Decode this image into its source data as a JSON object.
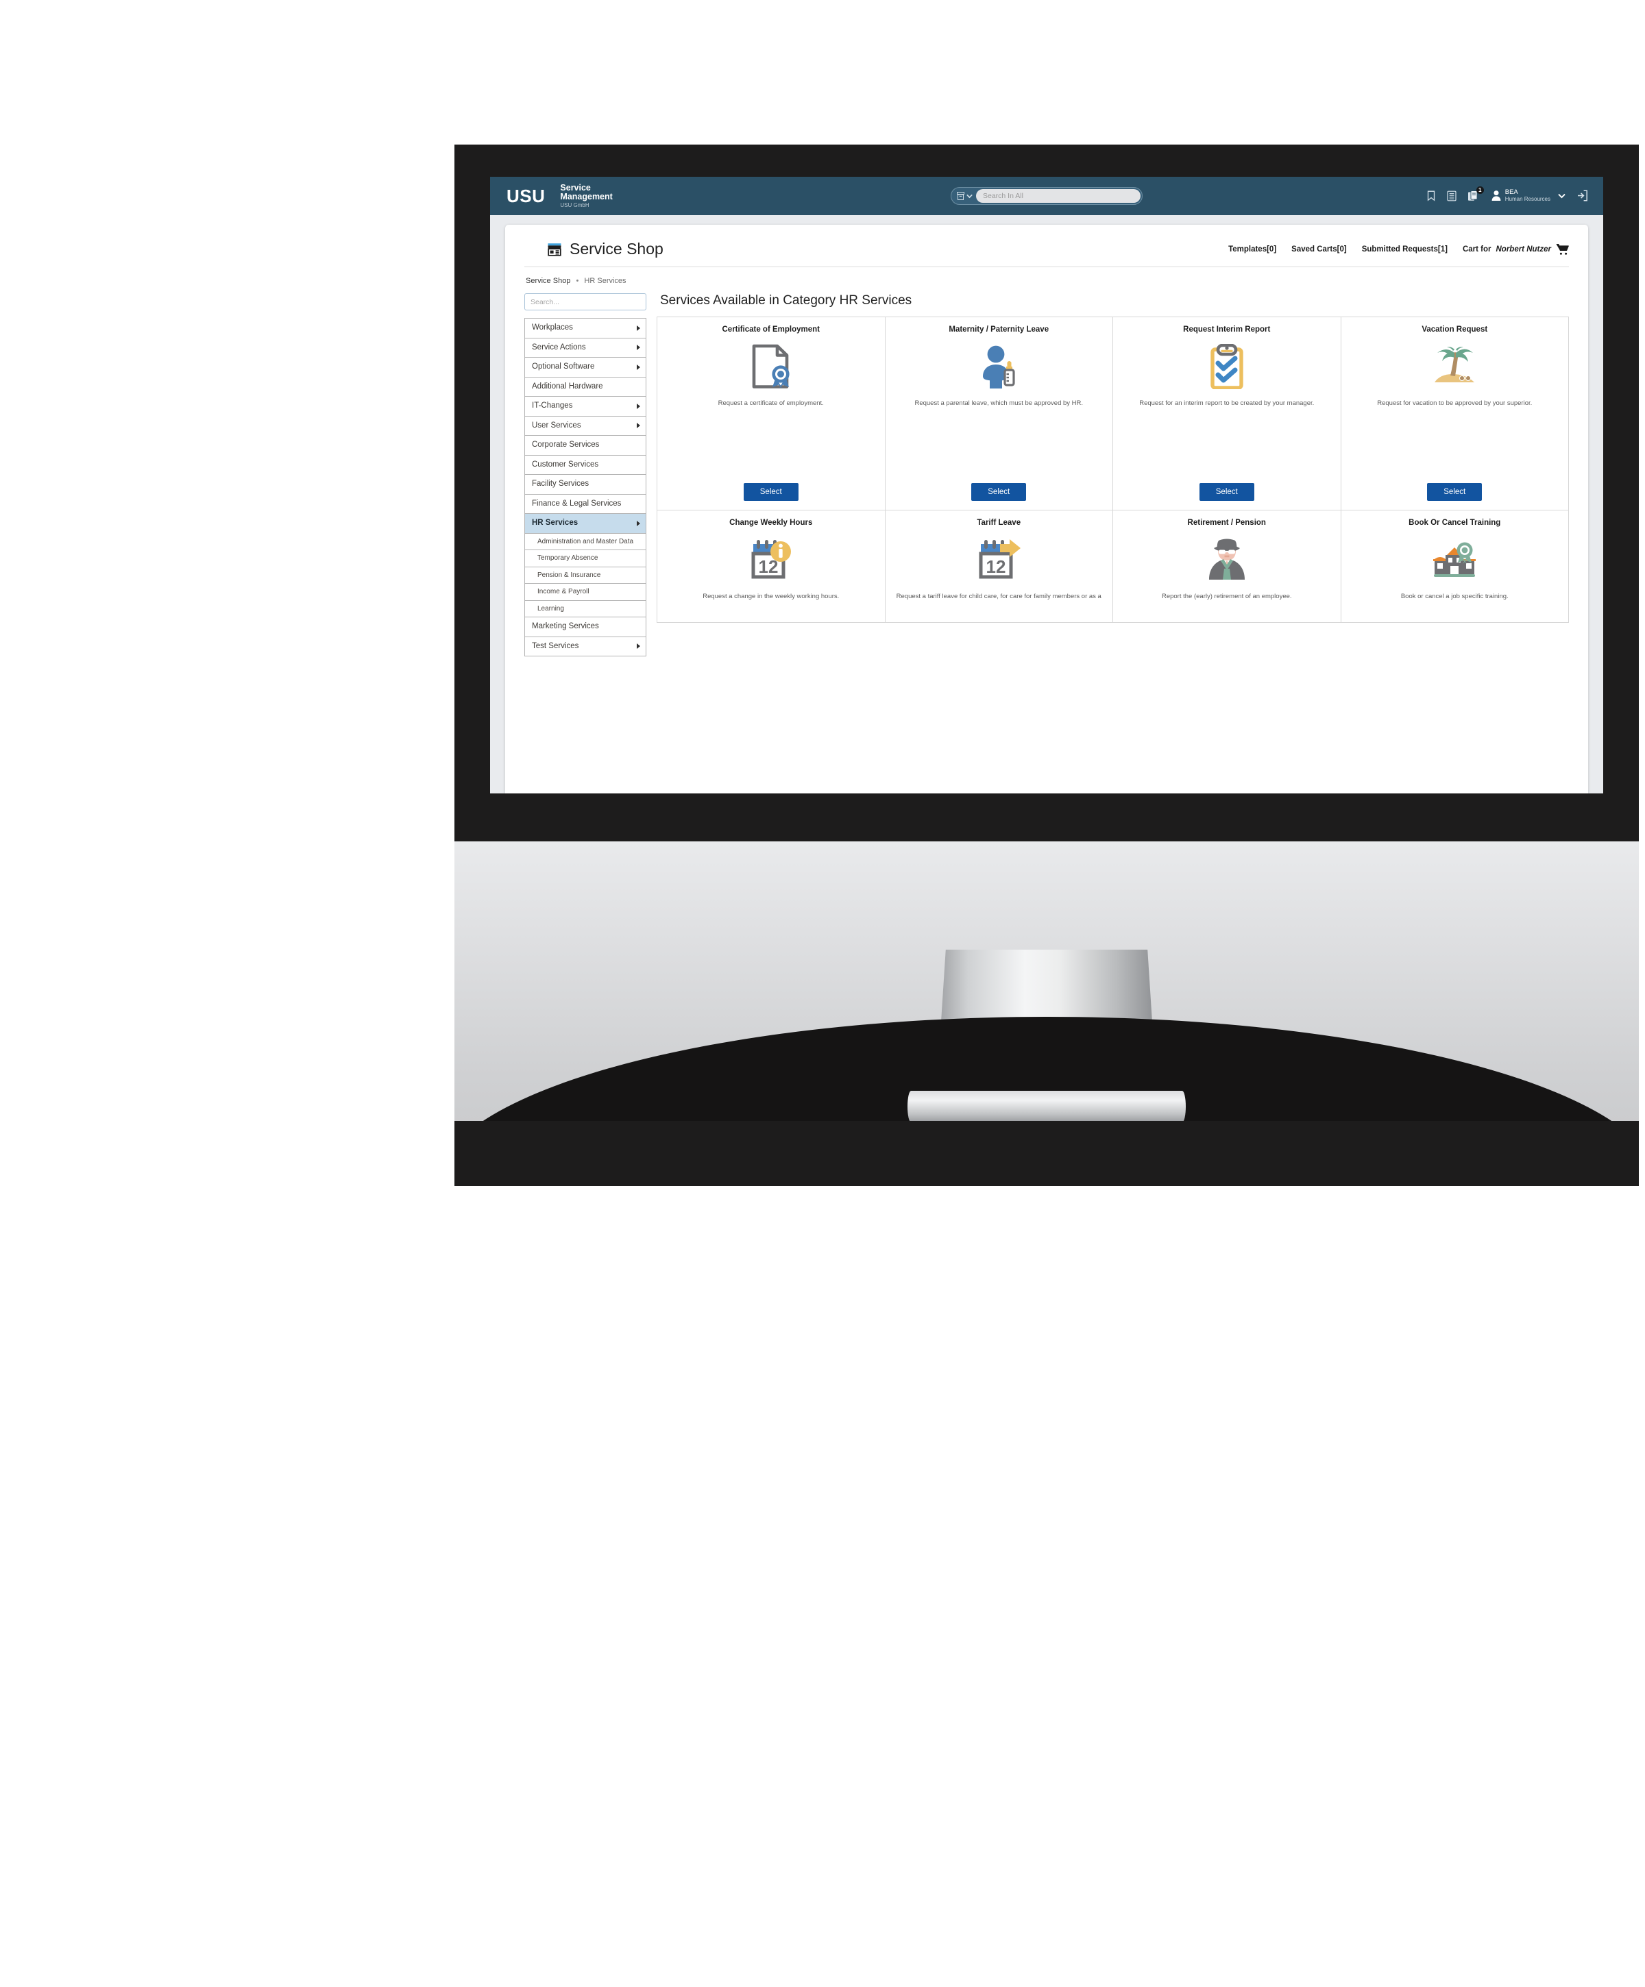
{
  "topbar": {
    "logo": "USU",
    "product_line1": "Service",
    "product_line2": "Management",
    "product_line3": "USU GmbH",
    "search_placeholder": "Search In All",
    "search_value": "",
    "notification_badge": "1",
    "user_name": "BEA",
    "user_role": "Human Resources",
    "icons": {
      "scope": "archive-icon",
      "scope_caret": "chevron-down-icon",
      "bookmark": "bookmark-icon",
      "list": "list-icon",
      "documents": "documents-icon",
      "avatar": "user-avatar-icon",
      "user_caret": "chevron-down-icon",
      "logout": "logout-icon"
    }
  },
  "shop": {
    "icon": "storefront-icon",
    "title": "Service Shop",
    "links": [
      {
        "label": "Templates",
        "count": "[0]"
      },
      {
        "label": "Saved Carts",
        "count": "[0]"
      },
      {
        "label": "Submitted Requests",
        "count": "[1]"
      }
    ],
    "cart_prefix": "Cart for",
    "cart_user": "Norbert Nutzer",
    "cart_icon": "shopping-cart-icon"
  },
  "breadcrumb": {
    "root": "Service Shop",
    "separator": "•",
    "current": "HR Services"
  },
  "sidebar": {
    "search_placeholder": "Search...",
    "search_value": "",
    "items": [
      {
        "label": "Workplaces",
        "arrow": true,
        "active": false,
        "sub": false
      },
      {
        "label": "Service Actions",
        "arrow": true,
        "active": false,
        "sub": false
      },
      {
        "label": "Optional Software",
        "arrow": true,
        "active": false,
        "sub": false
      },
      {
        "label": "Additional Hardware",
        "arrow": false,
        "active": false,
        "sub": false
      },
      {
        "label": "IT-Changes",
        "arrow": true,
        "active": false,
        "sub": false
      },
      {
        "label": "User Services",
        "arrow": true,
        "active": false,
        "sub": false
      },
      {
        "label": "Corporate Services",
        "arrow": false,
        "active": false,
        "sub": false
      },
      {
        "label": "Customer Services",
        "arrow": false,
        "active": false,
        "sub": false
      },
      {
        "label": "Facility Services",
        "arrow": false,
        "active": false,
        "sub": false
      },
      {
        "label": "Finance & Legal Services",
        "arrow": false,
        "active": false,
        "sub": false
      },
      {
        "label": "HR Services",
        "arrow": true,
        "active": true,
        "sub": false
      },
      {
        "label": "Administration and Master Data",
        "arrow": false,
        "active": false,
        "sub": true
      },
      {
        "label": "Temporary Absence",
        "arrow": false,
        "active": false,
        "sub": true
      },
      {
        "label": "Pension & Insurance",
        "arrow": false,
        "active": false,
        "sub": true
      },
      {
        "label": "Income & Payroll",
        "arrow": false,
        "active": false,
        "sub": true
      },
      {
        "label": "Learning",
        "arrow": false,
        "active": false,
        "sub": true
      },
      {
        "label": "Marketing Services",
        "arrow": false,
        "active": false,
        "sub": false
      },
      {
        "label": "Test Services",
        "arrow": true,
        "active": false,
        "sub": false
      }
    ]
  },
  "main": {
    "title": "Services Available in Category HR Services",
    "select_label": "Select",
    "cards_row1": [
      {
        "name": "Certificate of Employment",
        "desc": "Request a certificate of employment.",
        "icon": "document-seal-icon"
      },
      {
        "name": "Maternity / Paternity Leave",
        "desc": "Request a parental leave, which must be approved by HR.",
        "icon": "parent-baby-bottle-icon"
      },
      {
        "name": "Request Interim Report",
        "desc": "Request for an interim report to be created by your manager.",
        "icon": "clipboard-checks-icon"
      },
      {
        "name": "Vacation Request",
        "desc": "Request for vacation to be approved by your superior.",
        "icon": "palm-tree-beach-icon"
      }
    ],
    "cards_row2": [
      {
        "name": "Change Weekly Hours",
        "desc": "Request a change in the weekly working hours.",
        "icon": "calendar-info-icon"
      },
      {
        "name": "Tariff Leave",
        "desc": "Request a tariff leave for child care, for care for family members or as a",
        "icon": "calendar-arrow-icon"
      },
      {
        "name": "Retirement / Pension",
        "desc": "Report the (early) retirement of an employee.",
        "icon": "senior-person-icon"
      },
      {
        "name": "Book Or Cancel Training",
        "desc": "Book or cancel a job specific training.",
        "icon": "school-award-icon"
      }
    ]
  },
  "colors": {
    "topbar_blue": "#2b5066",
    "accent_blue": "#1254a0",
    "active_nav": "#c6dcec",
    "page_bg": "#e9ebee",
    "bezel": "#1d1c1c"
  }
}
